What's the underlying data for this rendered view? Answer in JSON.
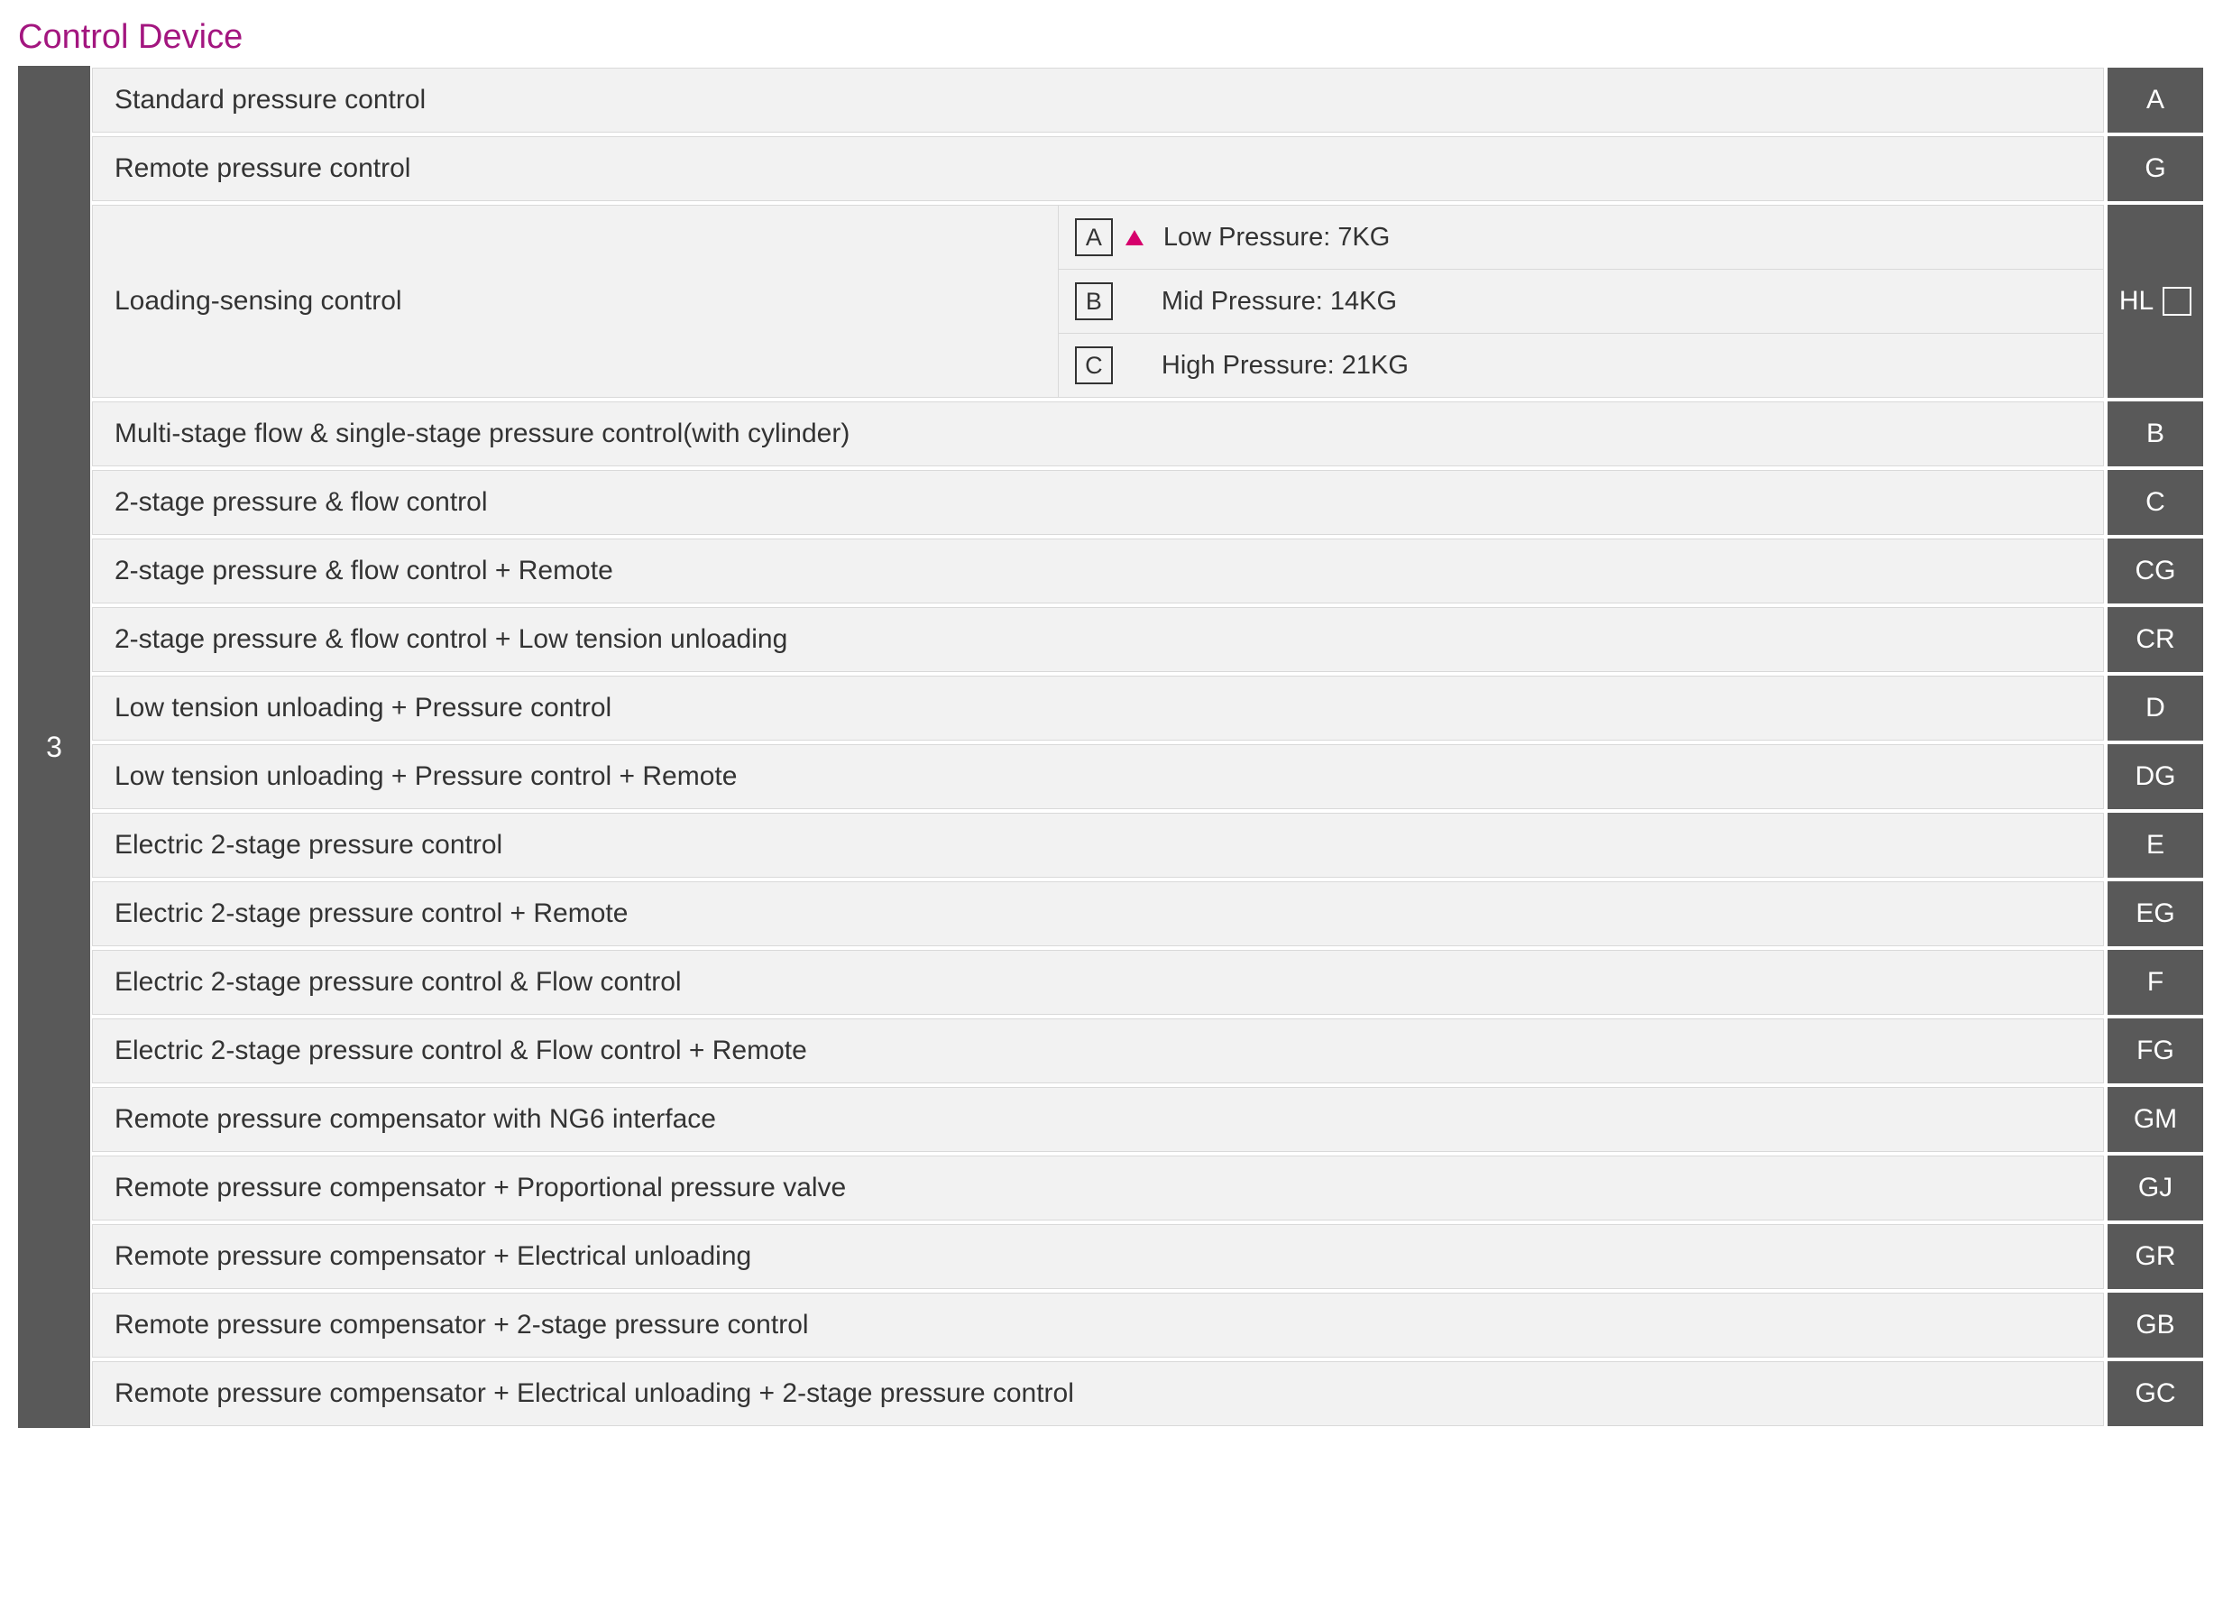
{
  "title": "Control Device",
  "index": "3",
  "rows": [
    {
      "desc": "Standard pressure control",
      "code": "A",
      "type": "simple"
    },
    {
      "desc": "Remote pressure control",
      "code": "G",
      "type": "simple"
    },
    {
      "desc": "Loading-sensing control",
      "code": "HL",
      "code_has_box": true,
      "type": "split",
      "sub": [
        {
          "letter": "A",
          "text": "Low Pressure: 7KG",
          "triangle": true
        },
        {
          "letter": "B",
          "text": "Mid Pressure: 14KG",
          "triangle": false
        },
        {
          "letter": "C",
          "text": "High Pressure: 21KG",
          "triangle": false
        }
      ]
    },
    {
      "desc": "Multi-stage flow & single-stage pressure control(with cylinder)",
      "code": "B",
      "type": "simple"
    },
    {
      "desc": "2-stage pressure & flow control",
      "code": "C",
      "type": "simple"
    },
    {
      "desc": "2-stage pressure & flow control + Remote",
      "code": "CG",
      "type": "simple"
    },
    {
      "desc": "2-stage pressure & flow control + Low tension unloading",
      "code": "CR",
      "type": "simple"
    },
    {
      "desc": "Low tension unloading + Pressure control",
      "code": "D",
      "type": "simple"
    },
    {
      "desc": "Low tension unloading + Pressure control + Remote",
      "code": "DG",
      "type": "simple"
    },
    {
      "desc": "Electric 2-stage pressure control",
      "code": "E",
      "type": "simple"
    },
    {
      "desc": "Electric 2-stage pressure control + Remote",
      "code": "EG",
      "type": "simple"
    },
    {
      "desc": "Electric 2-stage pressure control & Flow control",
      "code": "F",
      "type": "simple"
    },
    {
      "desc": "Electric 2-stage pressure control & Flow control + Remote",
      "code": "FG",
      "type": "simple"
    },
    {
      "desc": "Remote pressure compensator with NG6 interface",
      "code": "GM",
      "type": "simple"
    },
    {
      "desc": "Remote pressure compensator + Proportional pressure valve",
      "code": "GJ",
      "type": "simple"
    },
    {
      "desc": "Remote pressure compensator + Electrical unloading",
      "code": "GR",
      "type": "simple"
    },
    {
      "desc": "Remote pressure compensator + 2-stage pressure control",
      "code": "GB",
      "type": "simple"
    },
    {
      "desc": "Remote pressure compensator + Electrical unloading + 2-stage pressure control",
      "code": "GC",
      "type": "simple"
    }
  ]
}
